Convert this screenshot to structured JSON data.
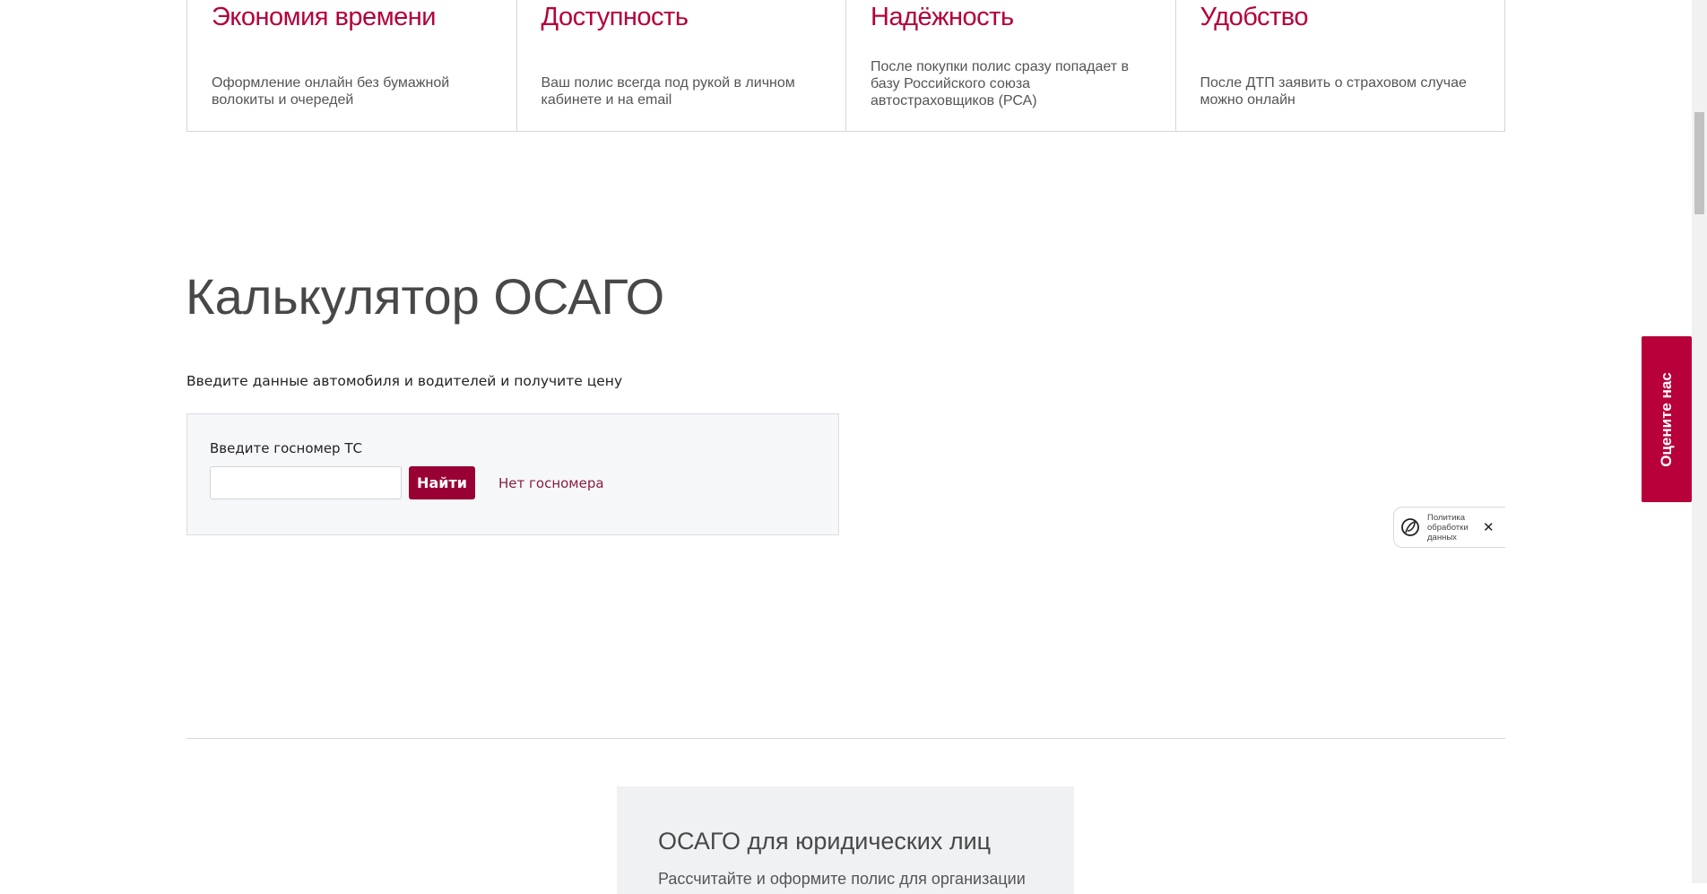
{
  "benefits": [
    {
      "title": "Экономия времени",
      "text": "Оформление онлайн без бумажной волокиты и очередей"
    },
    {
      "title": "Доступность",
      "text": "Ваш полис всегда под рукой в личном кабинете и на email"
    },
    {
      "title": "Надёжность",
      "text": "После покупки полис сразу попадает в базу Российского союза автостраховщиков (РСА)"
    },
    {
      "title": "Удобство",
      "text": "После ДТП заявить о страховом случае можно онлайн"
    }
  ],
  "calculator": {
    "title": "Калькулятор ОСАГО",
    "subtitle": "Введите данные автомобиля и водителей и получите цену",
    "plate_label": "Введите госномер ТС",
    "plate_value": "",
    "find_button": "Найти",
    "no_plate_link": "Нет госномера"
  },
  "legal": {
    "title": "ОСАГО для юридических лиц",
    "text": "Рассчитайте и оформите полис для организации"
  },
  "rate_us": "Оцените нас",
  "policy_widget": {
    "text": "Политика обработки данных",
    "close": "✕"
  }
}
